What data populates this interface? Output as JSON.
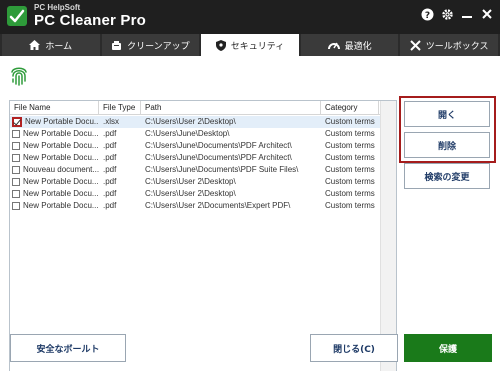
{
  "app": {
    "brand_top": "PC HelpSoft",
    "brand_main": "PC Cleaner Pro"
  },
  "window_controls": [
    "help-icon",
    "gear-icon",
    "minimize-icon",
    "close-icon"
  ],
  "tabs": [
    {
      "label": "ホーム",
      "icon": "home-icon",
      "active": false
    },
    {
      "label": "クリーンアップ",
      "icon": "cleanup-icon",
      "active": false
    },
    {
      "label": "セキュリティ",
      "icon": "shield-icon",
      "active": true
    },
    {
      "label": "最適化",
      "icon": "speedometer-icon",
      "active": false
    },
    {
      "label": "ツールボックス",
      "icon": "tools-icon",
      "active": false
    }
  ],
  "table": {
    "headers": [
      "File Name",
      "File Type",
      "Path",
      "Category"
    ],
    "rows": [
      {
        "name": "New Portable Docu...",
        "type": ".xlsx",
        "path": "C:\\Users\\User 2\\Desktop\\",
        "category": "Custom terms",
        "checked": true
      },
      {
        "name": "New Portable Docu...",
        "type": ".pdf",
        "path": "C:\\Users\\June\\Desktop\\",
        "category": "Custom terms",
        "checked": false
      },
      {
        "name": "New Portable Docu...",
        "type": ".pdf",
        "path": "C:\\Users\\June\\Documents\\PDF Architect\\",
        "category": "Custom terms",
        "checked": false
      },
      {
        "name": "New Portable Docu...",
        "type": ".pdf",
        "path": "C:\\Users\\June\\Documents\\PDF Architect\\",
        "category": "Custom terms",
        "checked": false
      },
      {
        "name": "Nouveau document...",
        "type": ".pdf",
        "path": "C:\\Users\\June\\Documents\\PDF Suite Files\\",
        "category": "Custom terms",
        "checked": false
      },
      {
        "name": "New Portable Docu...",
        "type": ".pdf",
        "path": "C:\\Users\\User 2\\Desktop\\",
        "category": "Custom terms",
        "checked": false
      },
      {
        "name": "New Portable Docu...",
        "type": ".pdf",
        "path": "C:\\Users\\User 2\\Desktop\\",
        "category": "Custom terms",
        "checked": false
      },
      {
        "name": "New Portable Docu...",
        "type": ".pdf",
        "path": "C:\\Users\\User 2\\Documents\\Expert PDF\\",
        "category": "Custom terms",
        "checked": false
      }
    ]
  },
  "actions": {
    "open": "開く",
    "delete": "削除",
    "change_search": "検索の変更"
  },
  "footer": {
    "vault": "安全なボールト",
    "close": "閉じる(C)",
    "save": "保護"
  },
  "colors": {
    "titlebar": "#1f1f1f",
    "highlight": "#a51c1c",
    "save_button": "#1a7a1a",
    "fingerprint": "#2e9b3a"
  }
}
